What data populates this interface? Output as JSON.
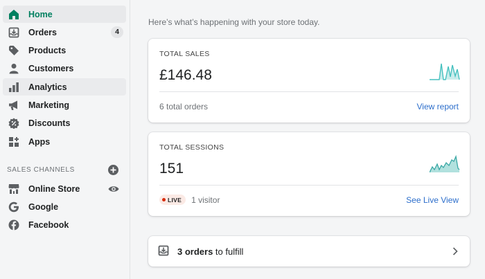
{
  "sidebar": {
    "items": [
      {
        "label": "Home",
        "icon": "home-icon"
      },
      {
        "label": "Orders",
        "icon": "orders-icon",
        "badge": "4"
      },
      {
        "label": "Products",
        "icon": "tag-icon"
      },
      {
        "label": "Customers",
        "icon": "person-icon"
      },
      {
        "label": "Analytics",
        "icon": "bar-chart-icon"
      },
      {
        "label": "Marketing",
        "icon": "megaphone-icon"
      },
      {
        "label": "Discounts",
        "icon": "discount-icon"
      },
      {
        "label": "Apps",
        "icon": "apps-icon"
      }
    ],
    "sales_channels_title": "SALES CHANNELS",
    "channels": [
      {
        "label": "Online Store",
        "icon": "store-icon"
      },
      {
        "label": "Google",
        "icon": "google-icon"
      },
      {
        "label": "Facebook",
        "icon": "facebook-icon"
      }
    ]
  },
  "main": {
    "subtitle": "Here’s what’s happening with your store today.",
    "total_sales": {
      "label": "TOTAL SALES",
      "value": "£146.48",
      "footer": "6 total orders",
      "link": "View report"
    },
    "total_sessions": {
      "label": "TOTAL SESSIONS",
      "value": "151",
      "live": "LIVE",
      "footer": "1 visitor",
      "link": "See Live View"
    },
    "fulfill": {
      "count": "3 orders",
      "text": " to fulfill"
    }
  },
  "colors": {
    "accent": "#008060",
    "link": "#2c6ecb",
    "sparkline": "#47c1bf",
    "live_dot": "#d82c0d"
  }
}
